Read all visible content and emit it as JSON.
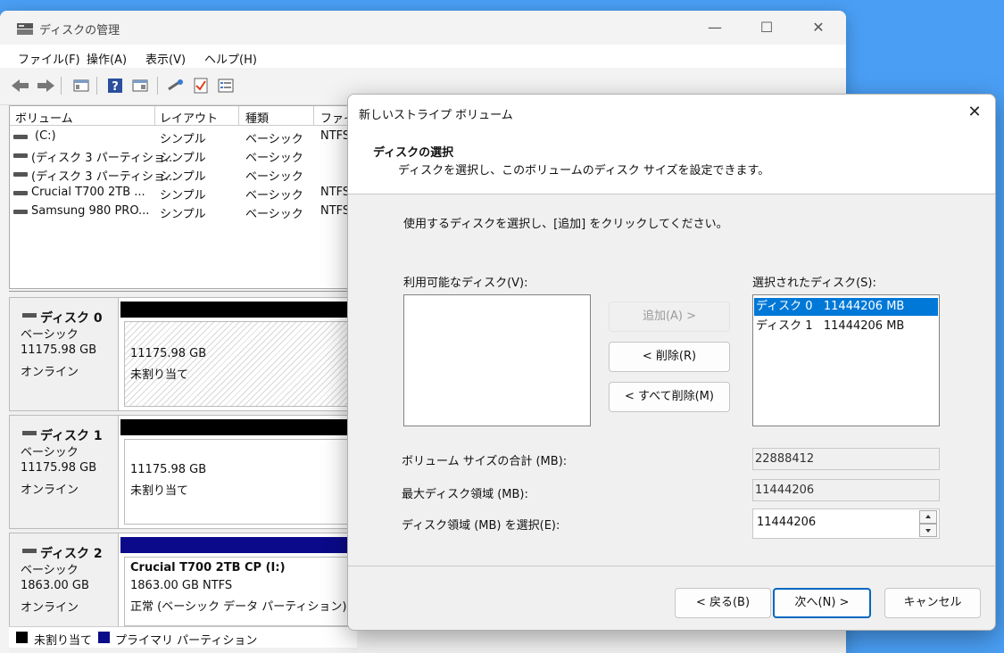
{
  "main_window": {
    "title": "ディスクの管理",
    "controls": {
      "minimize": "—",
      "maximize": "☐",
      "close": "✕"
    },
    "menu": [
      "ファイル(F)",
      "操作(A)",
      "表示(V)",
      "ヘルプ(H)"
    ]
  },
  "volume_list": {
    "columns": [
      "ボリューム",
      "レイアウト",
      "種類",
      "ファイ"
    ],
    "rows": [
      {
        "volume": "(C:)",
        "layout": "シンプル",
        "type": "ベーシック",
        "fs": "NTFS"
      },
      {
        "volume": "(ディスク 3 パーティショ...",
        "layout": "シンプル",
        "type": "ベーシック",
        "fs": ""
      },
      {
        "volume": "(ディスク 3 パーティショ...",
        "layout": "シンプル",
        "type": "ベーシック",
        "fs": ""
      },
      {
        "volume": "Crucial T700 2TB ...",
        "layout": "シンプル",
        "type": "ベーシック",
        "fs": "NTFS"
      },
      {
        "volume": "Samsung 980 PRO...",
        "layout": "シンプル",
        "type": "ベーシック",
        "fs": "NTFS"
      }
    ]
  },
  "disks": [
    {
      "name": "ディスク 0",
      "kind": "ベーシック",
      "size": "11175.98 GB",
      "status": "オンライン",
      "part_line1": "11175.98 GB",
      "part_line2": "未割り当て",
      "part_line3": ""
    },
    {
      "name": "ディスク 1",
      "kind": "ベーシック",
      "size": "11175.98 GB",
      "status": "オンライン",
      "part_line1": "11175.98 GB",
      "part_line2": "未割り当て",
      "part_line3": ""
    },
    {
      "name": "ディスク 2",
      "kind": "ベーシック",
      "size": "1863.00 GB",
      "status": "オンライン",
      "part_line1": "Crucial T700 2TB CP  (I:)",
      "part_line2": "1863.00 GB NTFS",
      "part_line3": "正常 (ベーシック データ パーティション)"
    }
  ],
  "legend": {
    "unallocated": "未割り当て",
    "primary": "プライマリ パーティション"
  },
  "colors": {
    "unallocated": "#000000",
    "primary": "#0a0a8a",
    "selection": "#0078d7",
    "desktop": "#4a9ff5"
  },
  "wizard": {
    "title": "新しいストライプ ボリューム",
    "close": "✕",
    "header_title": "ディスクの選択",
    "header_subtitle": "ディスクを選択し、このボリュームのディスク サイズを設定できます。",
    "instruction": "使用するディスクを選択し、[追加] をクリックしてください。",
    "available_label": "利用可能なディスク(V):",
    "selected_label": "選択されたディスク(S):",
    "selected_disks": [
      "ディスク 0   11444206 MB",
      "ディスク 1   11444206 MB"
    ],
    "add_button": "追加(A) >",
    "remove_button": "< 削除(R)",
    "remove_all_button": "< すべて削除(M)",
    "total_size_label": "ボリューム サイズの合計 (MB):",
    "total_size_value": "22888412",
    "max_space_label": "最大ディスク領域 (MB):",
    "max_space_value": "11444206",
    "select_space_label": "ディスク領域 (MB) を選択(E):",
    "select_space_value": "11444206",
    "back_button": "< 戻る(B)",
    "next_button": "次へ(N) >",
    "cancel_button": "キャンセル"
  }
}
